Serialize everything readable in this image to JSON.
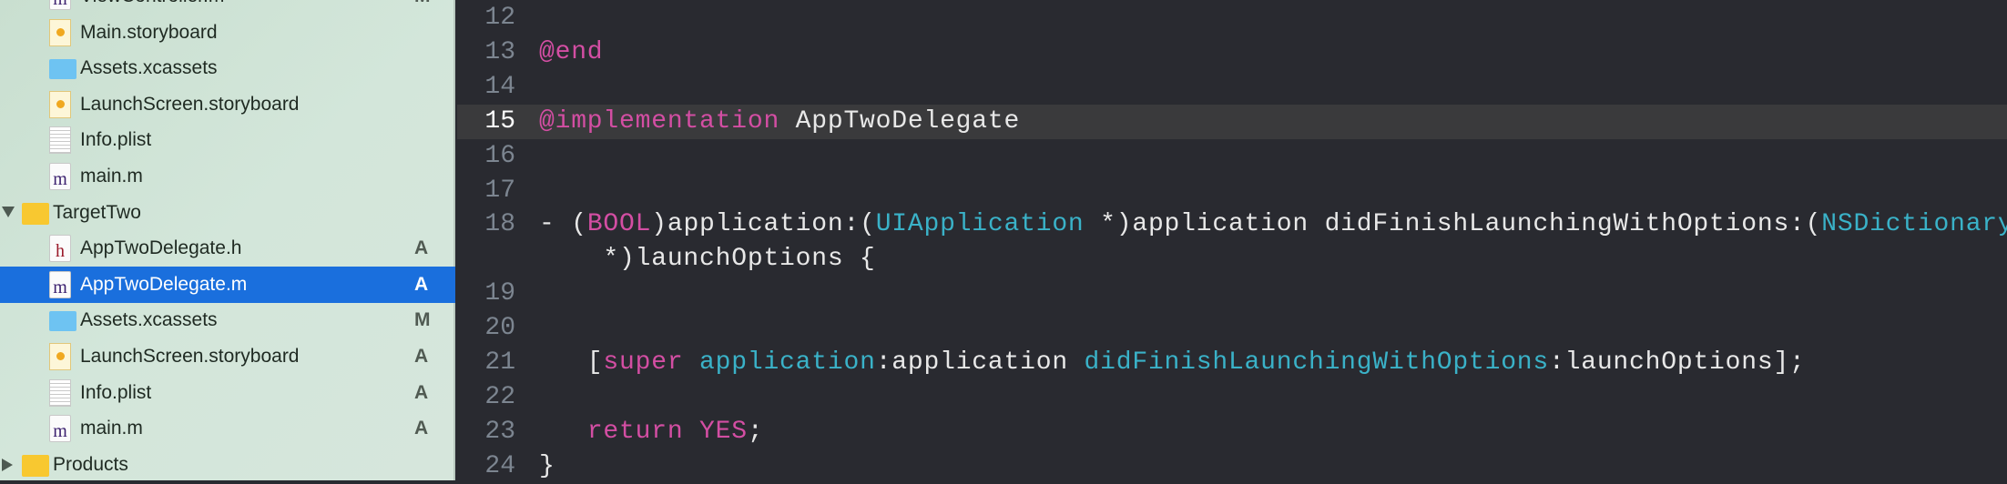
{
  "navigator": {
    "items": [
      {
        "label": "ViewController.m",
        "icon": "m-file-icon",
        "badge": "M",
        "depth": 2
      },
      {
        "label": "Main.storyboard",
        "icon": "storyboard-icon",
        "badge": "",
        "depth": 2
      },
      {
        "label": "Assets.xcassets",
        "icon": "assets-icon",
        "badge": "",
        "depth": 2
      },
      {
        "label": "LaunchScreen.storyboard",
        "icon": "storyboard-icon",
        "badge": "",
        "depth": 2
      },
      {
        "label": "Info.plist",
        "icon": "plist-icon",
        "badge": "",
        "depth": 2
      },
      {
        "label": "main.m",
        "icon": "m-file-icon",
        "badge": "",
        "depth": 2
      },
      {
        "label": "TargetTwo",
        "icon": "folder-icon",
        "badge": "",
        "depth": 1,
        "expanded": true
      },
      {
        "label": "AppTwoDelegate.h",
        "icon": "h-file-icon",
        "badge": "A",
        "depth": 2
      },
      {
        "label": "AppTwoDelegate.m",
        "icon": "m-file-icon",
        "badge": "A",
        "depth": 2,
        "selected": true
      },
      {
        "label": "Assets.xcassets",
        "icon": "assets-icon",
        "badge": "M",
        "depth": 2
      },
      {
        "label": "LaunchScreen.storyboard",
        "icon": "storyboard-icon",
        "badge": "A",
        "depth": 2
      },
      {
        "label": "Info.plist",
        "icon": "plist-icon",
        "badge": "A",
        "depth": 2
      },
      {
        "label": "main.m",
        "icon": "m-file-icon",
        "badge": "A",
        "depth": 2
      },
      {
        "label": "Products",
        "icon": "products-folder-icon",
        "badge": "",
        "depth": 1,
        "expanded": false
      }
    ]
  },
  "editor": {
    "current_line": "15",
    "colors": {
      "keyword": "#d34ea3",
      "type": "#3ab2c8",
      "text": "#e8e8e8",
      "background": "#292a30"
    },
    "lines": [
      {
        "num": "12",
        "tokens": []
      },
      {
        "num": "13",
        "tokens": [
          {
            "t": "@end",
            "c": "kw"
          }
        ]
      },
      {
        "num": "14",
        "tokens": []
      },
      {
        "num": "15",
        "tokens": [
          {
            "t": "@implementation",
            "c": "kw"
          },
          {
            "t": " AppTwoDelegate",
            "c": ""
          }
        ]
      },
      {
        "num": "16",
        "tokens": []
      },
      {
        "num": "17",
        "tokens": []
      },
      {
        "num": "18",
        "tokens": [
          {
            "t": "- (",
            "c": ""
          },
          {
            "t": "BOOL",
            "c": "kw"
          },
          {
            "t": ")application:(",
            "c": ""
          },
          {
            "t": "UIApplication",
            "c": "ty"
          },
          {
            "t": " *)application didFinishLaunchingWithOptions:(",
            "c": ""
          },
          {
            "t": "NSDictionary",
            "c": "ty"
          }
        ]
      },
      {
        "num": "",
        "tokens": [
          {
            "t": "    *)launchOptions {",
            "c": ""
          }
        ]
      },
      {
        "num": "19",
        "tokens": []
      },
      {
        "num": "20",
        "tokens": []
      },
      {
        "num": "21",
        "tokens": [
          {
            "t": "   [",
            "c": ""
          },
          {
            "t": "super",
            "c": "kw"
          },
          {
            "t": " ",
            "c": ""
          },
          {
            "t": "application",
            "c": "ty"
          },
          {
            "t": ":application ",
            "c": ""
          },
          {
            "t": "didFinishLaunchingWithOptions",
            "c": "ty"
          },
          {
            "t": ":launchOptions];",
            "c": ""
          }
        ]
      },
      {
        "num": "22",
        "tokens": []
      },
      {
        "num": "23",
        "tokens": [
          {
            "t": "   ",
            "c": ""
          },
          {
            "t": "return",
            "c": "kw"
          },
          {
            "t": " ",
            "c": ""
          },
          {
            "t": "YES",
            "c": "kw"
          },
          {
            "t": ";",
            "c": ""
          }
        ]
      },
      {
        "num": "24",
        "tokens": [
          {
            "t": "}",
            "c": ""
          }
        ]
      }
    ]
  }
}
